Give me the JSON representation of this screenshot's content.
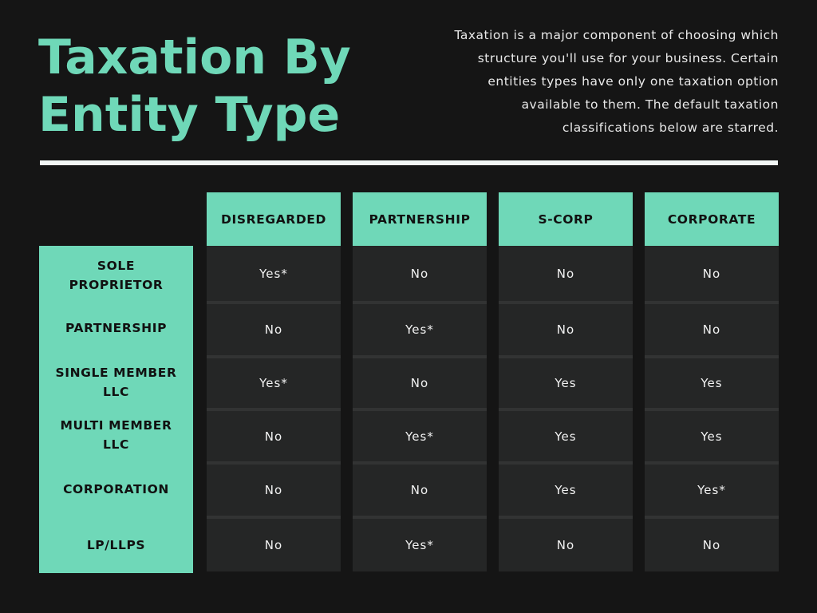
{
  "header": {
    "title_line1": "Taxation By",
    "title_line2": "Entity Type",
    "description": "Taxation is a major component of choosing which structure you'll use for your business. Certain entities types have only one taxation option available to them. The default taxation classifications below are starred."
  },
  "colors": {
    "accent": "#6fd8b8",
    "background": "#151515",
    "cell": "#252626"
  },
  "table": {
    "columns": [
      "DISREGARDED",
      "PARTNERSHIP",
      "S-CORP",
      "CORPORATE"
    ],
    "rows": [
      {
        "label_line1": "SOLE",
        "label_line2": "PROPRIETOR",
        "values": [
          "Yes*",
          "No",
          "No",
          "No"
        ]
      },
      {
        "label_line1": "PARTNERSHIP",
        "label_line2": "",
        "values": [
          "No",
          "Yes*",
          "No",
          "No"
        ]
      },
      {
        "label_line1": "SINGLE MEMBER",
        "label_line2": "LLC",
        "values": [
          "Yes*",
          "No",
          "Yes",
          "Yes"
        ]
      },
      {
        "label_line1": "MULTI MEMBER",
        "label_line2": "LLC",
        "values": [
          "No",
          "Yes*",
          "Yes",
          "Yes"
        ]
      },
      {
        "label_line1": "CORPORATION",
        "label_line2": "",
        "values": [
          "No",
          "No",
          "Yes",
          "Yes*"
        ]
      },
      {
        "label_line1": "LP/LLPS",
        "label_line2": "",
        "values": [
          "No",
          "Yes*",
          "No",
          "No"
        ]
      }
    ]
  }
}
